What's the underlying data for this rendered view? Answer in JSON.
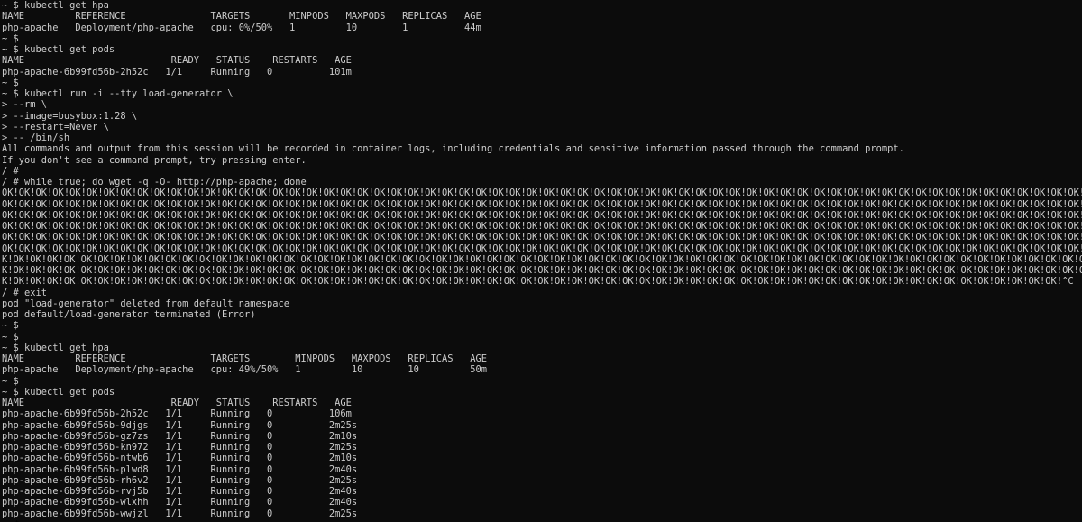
{
  "terminal": {
    "lines": [
      "~ $ kubectl get hpa",
      "NAME         REFERENCE               TARGETS       MINPODS   MAXPODS   REPLICAS   AGE",
      "php-apache   Deployment/php-apache   cpu: 0%/50%   1         10        1          44m",
      "~ $",
      "~ $ kubectl get pods",
      "NAME                          READY   STATUS    RESTARTS   AGE",
      "php-apache-6b99fd56b-2h52c   1/1     Running   0          101m",
      "~ $",
      "~ $ kubectl run -i --tty load-generator \\",
      "> --rm \\",
      "> --image=busybox:1.28 \\",
      "> --restart=Never \\",
      "> -- /bin/sh",
      "All commands and output from this session will be recorded in container logs, including credentials and sensitive information passed through the command prompt.",
      "If you don't see a command prompt, try pressing enter.",
      "/ #",
      "/ # while true; do wget -q -O- http://php-apache; done",
      "OK!OK!OK!OK!OK!OK!OK!OK!OK!OK!OK!OK!OK!OK!OK!OK!OK!OK!OK!OK!OK!OK!OK!OK!OK!OK!OK!OK!OK!OK!OK!OK!OK!OK!OK!OK!OK!OK!OK!OK!OK!OK!OK!OK!OK!OK!OK!OK!OK!OK!OK!OK!OK!OK!OK!OK!OK!OK!OK!OK!OK!OK!OK!OK!OK!OK!OK!OK!OK!OK!OK!OK!OK!OK!OK!OK!OK!OK!OK!OK!",
      "OK!OK!OK!OK!OK!OK!OK!OK!OK!OK!OK!OK!OK!OK!OK!OK!OK!OK!OK!OK!OK!OK!OK!OK!OK!OK!OK!OK!OK!OK!OK!OK!OK!OK!OK!OK!OK!OK!OK!OK!OK!OK!OK!OK!OK!OK!OK!OK!OK!OK!OK!OK!OK!OK!OK!OK!OK!OK!OK!OK!OK!OK!OK!OK!OK!OK!OK!OK!OK!OK!OK!OK!OK!OK!OK!OK!OK!OK!OK!OK!",
      "OK!OK!OK!OK!OK!OK!OK!OK!OK!OK!OK!OK!OK!OK!OK!OK!OK!OK!OK!OK!OK!OK!OK!OK!OK!OK!OK!OK!OK!OK!OK!OK!OK!OK!OK!OK!OK!OK!OK!OK!OK!OK!OK!OK!OK!OK!OK!OK!OK!OK!OK!OK!OK!OK!OK!OK!OK!OK!OK!OK!OK!OK!OK!OK!OK!OK!OK!OK!OK!OK!OK!OK!OK!OK!OK!OK!OK!OK!OK!OK!",
      "OK!OK!OK!OK!OK!OK!OK!OK!OK!OK!OK!OK!OK!OK!OK!OK!OK!OK!OK!OK!OK!OK!OK!OK!OK!OK!OK!OK!OK!OK!OK!OK!OK!OK!OK!OK!OK!OK!OK!OK!OK!OK!OK!OK!OK!OK!OK!OK!OK!OK!OK!OK!OK!OK!OK!OK!OK!OK!OK!OK!OK!OK!OK!OK!OK!OK!OK!OK!OK!OK!OK!OK!OK!OK!OK!OK!OK!OK!OK!OK!",
      "OK!OK!OK!OK!OK!OK!OK!OK!OK!OK!OK!OK!OK!OK!OK!OK!OK!OK!OK!OK!OK!OK!OK!OK!OK!OK!OK!OK!OK!OK!OK!OK!OK!OK!OK!OK!OK!OK!OK!OK!OK!OK!OK!OK!OK!OK!OK!OK!OK!OK!OK!OK!OK!OK!OK!OK!OK!OK!OK!OK!OK!OK!OK!OK!OK!OK!OK!OK!OK!OK!OK!OK!OK!OK!OK!OK!OK!OK!OK!OK!",
      "OK!OK!OK!OK!OK!OK!OK!OK!OK!OK!OK!OK!OK!OK!OK!OK!OK!OK!OK!OK!OK!OK!OK!OK!OK!OK!OK!OK!OK!OK!OK!OK!OK!OK!OK!OK!OK!OK!OK!OK!OK!OK!OK!OK!OK!OK!OK!OK!OK!OK!OK!OK!OK!OK!OK!OK!OK!OK!OK!OK!OK!OK!OK!OK!OK!OK!OK!OK!OK!OK!OK!OK!OK!OK!OK!OK!OK!OK!OK!OK!OK",
      "K!OK!OK!OK!OK!OK!OK!OK!OK!OK!OK!OK!OK!OK!OK!OK!OK!OK!OK!OK!OK!OK!OK!OK!OK!OK!OK!OK!OK!OK!OK!OK!OK!OK!OK!OK!OK!OK!OK!OK!OK!OK!OK!OK!OK!OK!OK!OK!OK!OK!OK!OK!OK!OK!OK!OK!OK!OK!OK!OK!OK!OK!OK!OK!OK!OK!OK!OK!OK!OK!OK!OK!OK!OK!OK!OK!OK!OK!OK!OK!O",
      "K!OK!OK!OK!OK!OK!OK!OK!OK!OK!OK!OK!OK!OK!OK!OK!OK!OK!OK!OK!OK!OK!OK!OK!OK!OK!OK!OK!OK!OK!OK!OK!OK!OK!OK!OK!OK!OK!OK!OK!OK!OK!OK!OK!OK!OK!OK!OK!OK!OK!OK!OK!OK!OK!OK!OK!OK!OK!OK!OK!OK!OK!OK!OK!OK!OK!OK!OK!OK!OK!OK!OK!OK!OK!OK!OK!OK!OK!OK!OK!O",
      "K!OK!OK!OK!OK!OK!OK!OK!OK!OK!OK!OK!OK!OK!OK!OK!OK!OK!OK!OK!OK!OK!OK!OK!OK!OK!OK!OK!OK!OK!OK!OK!OK!OK!OK!OK!OK!OK!OK!OK!OK!OK!OK!OK!OK!OK!OK!OK!OK!OK!OK!OK!OK!OK!OK!OK!OK!OK!OK!OK!OK!OK!OK!^C",
      "/ # exit",
      "pod \"load-generator\" deleted from default namespace",
      "pod default/load-generator terminated (Error)",
      "~ $",
      "~ $",
      "~ $ kubectl get hpa",
      "NAME         REFERENCE               TARGETS        MINPODS   MAXPODS   REPLICAS   AGE",
      "php-apache   Deployment/php-apache   cpu: 49%/50%   1         10        10         50m",
      "~ $",
      "~ $ kubectl get pods",
      "NAME                          READY   STATUS    RESTARTS   AGE",
      "php-apache-6b99fd56b-2h52c   1/1     Running   0          106m",
      "php-apache-6b99fd56b-9djgs   1/1     Running   0          2m25s",
      "php-apache-6b99fd56b-gz7zs   1/1     Running   0          2m10s",
      "php-apache-6b99fd56b-kn972   1/1     Running   0          2m25s",
      "php-apache-6b99fd56b-ntwb6   1/1     Running   0          2m10s",
      "php-apache-6b99fd56b-plwd8   1/1     Running   0          2m40s",
      "php-apache-6b99fd56b-rh6v2   1/1     Running   0          2m25s",
      "php-apache-6b99fd56b-rvj5b   1/1     Running   0          2m40s",
      "php-apache-6b99fd56b-wlxhh   1/1     Running   0          2m40s",
      "php-apache-6b99fd56b-wwjzl   1/1     Running   0          2m25s"
    ],
    "prompt": "~ $ "
  },
  "colors": {
    "background": "#0c0c0c",
    "foreground": "#cccccc",
    "cursor": "#e8e8e8"
  }
}
